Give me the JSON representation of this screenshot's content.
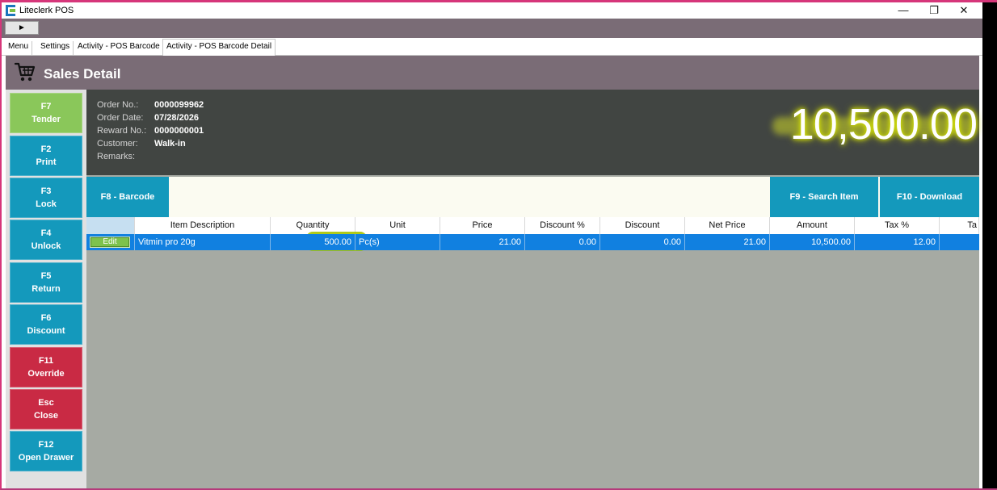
{
  "window": {
    "title": "Liteclerk POS",
    "minimize_glyph": "—",
    "restore_glyph": "❐",
    "close_glyph": "✕"
  },
  "toolbar": {
    "play_glyph": "►"
  },
  "tabs": [
    {
      "label": "Menu"
    },
    {
      "label": "Settings"
    },
    {
      "label": "Activity - POS Barcode"
    },
    {
      "label": "Activity - POS Barcode Detail"
    }
  ],
  "page": {
    "title": "Sales Detail"
  },
  "sidebar": {
    "buttons": [
      {
        "key": "F7",
        "label": "Tender"
      },
      {
        "key": "F2",
        "label": "Print"
      },
      {
        "key": "F3",
        "label": "Lock"
      },
      {
        "key": "F4",
        "label": "Unlock"
      },
      {
        "key": "F5",
        "label": "Return"
      },
      {
        "key": "F6",
        "label": "Discount"
      },
      {
        "key": "F11",
        "label": "Override"
      },
      {
        "key": "Esc",
        "label": "Close"
      },
      {
        "key": "F12",
        "label": "Open Drawer"
      }
    ]
  },
  "order": {
    "order_no_label": "Order No.:",
    "order_no": "0000099962",
    "order_date_label": "Order Date:",
    "order_date": "07/28/2026",
    "reward_no_label": "Reward No.:",
    "reward_no": "0000000001",
    "customer_label": "Customer:",
    "customer": "Walk-in",
    "remarks_label": "Remarks:",
    "remarks": "",
    "total": "10,500.00"
  },
  "barcode_bar": {
    "barcode_button": "F8 - Barcode",
    "barcode_value": "",
    "search_button": "F9 - Search Item",
    "download_button": "F10 - Download"
  },
  "grid": {
    "columns": [
      "",
      "Item Description",
      "Quantity",
      "Unit",
      "Price",
      "Discount %",
      "Discount",
      "Net Price",
      "Amount",
      "Tax %",
      "Ta"
    ],
    "rows": [
      {
        "edit_label": "Edit",
        "item_description": "Vitmin pro 20g",
        "quantity": "500.00",
        "unit": "Pc(s)",
        "price": "21.00",
        "discount_pct": "0.00",
        "discount": "0.00",
        "net_price": "21.00",
        "amount": "10,500.00",
        "tax_pct": "12.00",
        "tax": ""
      }
    ]
  },
  "colors": {
    "header_mauve": "#7a6c76",
    "button_blue": "#1499bc",
    "button_green": "#8ac75a",
    "button_red": "#c92a44",
    "info_dark": "#414542",
    "row_selected": "#1180e0",
    "grid_bg": "#a6aaa3"
  }
}
